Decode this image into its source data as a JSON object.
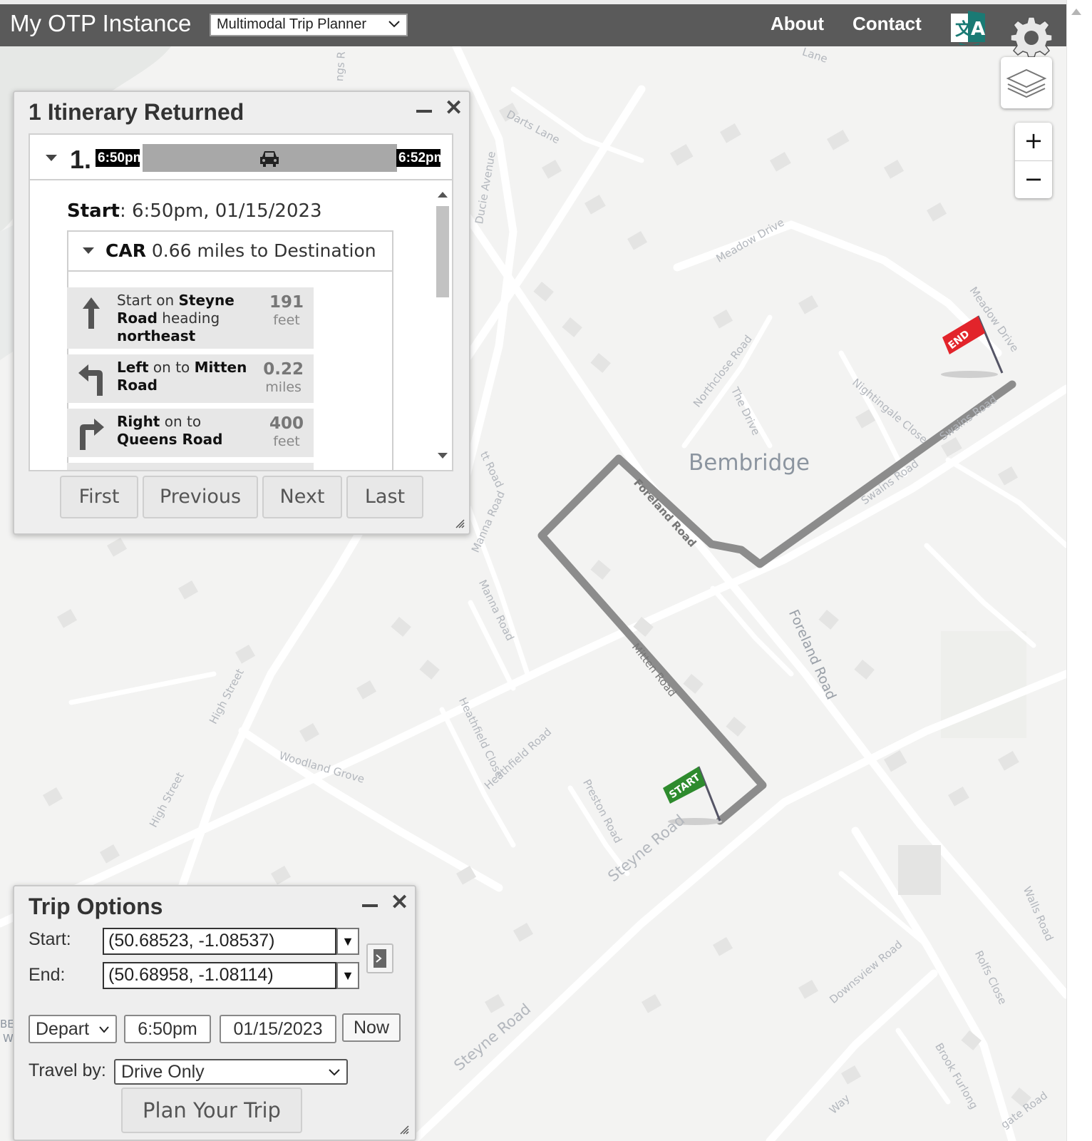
{
  "header": {
    "app_title": "My OTP Instance",
    "mode_selector": "Multimodal Trip Planner",
    "nav": {
      "about": "About",
      "contact": "Contact"
    },
    "icons": {
      "language": "language-icon",
      "settings": "gear-icon"
    }
  },
  "map": {
    "town": "Bembridge",
    "streets": [
      "Darts Lane",
      "Ducie Avenue",
      "Meadow Drive",
      "Meadow Drive",
      "Northclose Road",
      "The Drive",
      "Nightingale Close",
      "Swains Road",
      "Swains Road",
      "Foreland Road",
      "Foreland Road",
      "Manna Road",
      "Manna Road",
      "Mitten Road",
      "Heathfield Close",
      "Heathfield Road",
      "Preston Road",
      "Steyne Road",
      "Steyne Road",
      "Woodland Grove",
      "High Street",
      "High Street",
      "Downsview Road",
      "Brook Furlong",
      "Rolfs Close",
      "Walls Road",
      "Lane",
      "Way",
      "gate Road",
      "tt Road",
      "ngs R"
    ],
    "markers": {
      "start": "START",
      "end": "END"
    },
    "colors": {
      "route": "#8c8c8c",
      "start_flag": "#2e8b2e",
      "end_flag": "#e2242b",
      "background": "#f3f3f2"
    },
    "controls": {
      "zoom_in": "+",
      "zoom_out": "−",
      "layers_icon": "layers-icon"
    }
  },
  "itinerary_panel": {
    "title": "1 Itinerary Returned",
    "item_number": "1.",
    "depart_time": "6:50pm",
    "arrive_time": "6:52pm",
    "mode_icon": "car-icon",
    "start_label": "Start",
    "start_value": ": 6:50pm, 01/15/2023",
    "leg": {
      "mode": "CAR",
      "summary": " 0.66 miles to Destination"
    },
    "steps": [
      {
        "icon": "arrow-up-icon",
        "parts": [
          "Start on ",
          "Steyne Road",
          " heading ",
          "northeast"
        ],
        "distance": "191",
        "unit": "feet"
      },
      {
        "icon": "turn-left-icon",
        "parts": [
          "Left",
          " on to ",
          "Mitten Road"
        ],
        "distance": "0.22",
        "unit": "miles"
      },
      {
        "icon": "turn-right-icon",
        "parts": [
          "Right",
          " on to ",
          "Queens Road"
        ],
        "distance": "400",
        "unit": "feet"
      }
    ],
    "pager": {
      "first": "First",
      "previous": "Previous",
      "next": "Next",
      "last": "Last"
    }
  },
  "trip_options": {
    "title": "Trip Options",
    "start_label": "Start:",
    "start_value": "(50.68523, -1.08537)",
    "end_label": "End:",
    "end_value": "(50.68958, -1.08114)",
    "depart_arrive": "Depart",
    "time": "6:50pm",
    "date": "01/15/2023",
    "now": "Now",
    "travel_by_label": "Travel by:",
    "travel_by_value": "Drive Only",
    "plan_button": "Plan Your Trip",
    "dropdown_glyph": "▼"
  },
  "edge_labels": {
    "left_a": "BE",
    "left_b": "W"
  }
}
